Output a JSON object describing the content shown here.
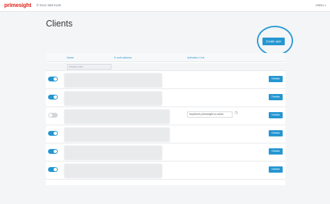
{
  "header": {
    "logo": "primesight",
    "phone": "0141 559 6126",
    "user": "ANNA"
  },
  "page": {
    "title": "Clients",
    "create_button": "Create user"
  },
  "table": {
    "columns": [
      "Name",
      "E-mail address",
      "Activation Link"
    ],
    "search_placeholder": "Search user",
    "rows": [
      {
        "active": true,
        "activation_link": "",
        "details": "Details"
      },
      {
        "active": true,
        "activation_link": "",
        "details": "Details"
      },
      {
        "active": false,
        "activation_link": "buydirect.primesight.co.uk/ke",
        "details": "Details"
      },
      {
        "active": true,
        "activation_link": "",
        "details": "Details"
      },
      {
        "active": true,
        "activation_link": "",
        "details": "Details"
      },
      {
        "active": true,
        "activation_link": "",
        "details": "Details"
      }
    ]
  },
  "colors": {
    "accent": "#2596d1",
    "brand": "#e2231a"
  }
}
